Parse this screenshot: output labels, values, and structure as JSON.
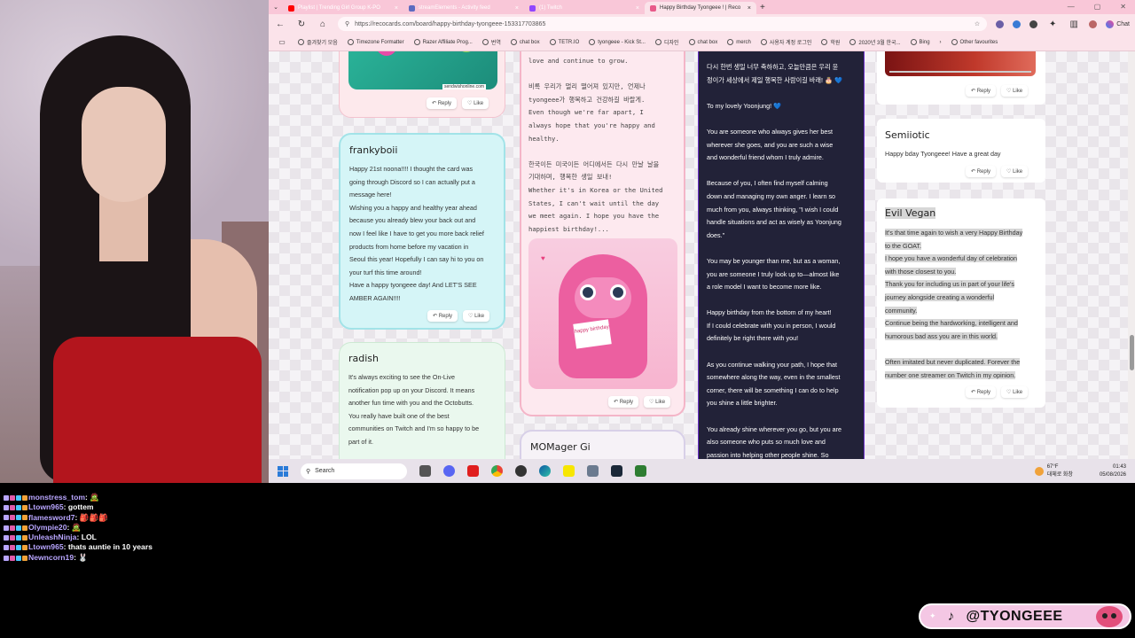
{
  "browser": {
    "tabs": [
      {
        "label": "Playlist | Trending Girl Group K-PO",
        "color": "#ff0000"
      },
      {
        "label": "streamElements - Activity feed",
        "color": "#5c6bc0"
      },
      {
        "label": "(1) Twitch",
        "color": "#9146ff"
      },
      {
        "label": "Happy Birthday Tyongeee ! | Reco",
        "color": "#e85a8a",
        "active": true
      }
    ],
    "new_tab": "+",
    "close_glyph": "×",
    "url": "https://recocards.com/board/happy-birthday-tyongeee-153317703865",
    "chat_label": "Chat",
    "bookmarks": [
      "즐겨찾기 모음",
      "Timezone Formatter",
      "Razer Affiliate Prog...",
      "번역",
      "chat box",
      "TETR.IO",
      "tyongeee - Kick St...",
      "디자인",
      "chat box",
      "merch",
      "사용자 계정 로그인",
      "학원",
      "2020년 3월 한국...",
      "Bing"
    ],
    "other_favourites": "Other favourites"
  },
  "board": {
    "reply": "Reply",
    "like": "Like",
    "col1": {
      "gif_caption": "sendwishonline.com",
      "frankyboii": {
        "name": "frankyboii",
        "lines": [
          "Happy 21st noona!!!! I thought the card was",
          "going through Discord so I can actually put a",
          "message here!",
          "Wishing you a happy and healthy year ahead",
          "because you already blew your back out and",
          "now I feel like I have to get you more back relief",
          "products from home before my vacation in",
          "Seoul this year! Hopefully I can say hi to you on",
          "your turf this time around!",
          "Have a happy tyongeee day! And LET'S SEE",
          "AMBER AGAIN!!!!"
        ]
      },
      "radish": {
        "name": "radish",
        "lines": [
          "It's always exciting to see the On-Live",
          "notification pop up on your Discord.  It means",
          "another fun time with you and the Octobutts.",
          "You really have built one of the best",
          "communities on Twitch and I'm so happy to be",
          "part of it."
        ]
      }
    },
    "col2": {
      "lines": [
        "love and continue to grow.",
        "",
        "비록 우리가 멀리 떨어져 있지만, 언제나",
        "tyongeee가 행복하고 건강하길 바랄게.",
        "Even though we're far apart, I",
        "always hope that you're happy and",
        "healthy.",
        "",
        "한국이든 미국이든 어디에서든 다시 만날 날을",
        "기대하며, 행복한 생일 보내!",
        "Whether it's in Korea or the United",
        "States, I can't wait until the day",
        "we meet again. I hope you have the",
        "happiest birthday!..."
      ],
      "sign_text": "happy birthday",
      "next_name": "MOMager Gi"
    },
    "col3": {
      "lines": [
        "다시 한번 생일 너무 축하하고, 오늘만큼은 우리 윤",
        "정이가 세상에서 제일 행복한 사람이길 바래! 🎂 💙",
        "",
        "To my lovely Yoonjung! 💙",
        "",
        "You are someone who always gives her best",
        "wherever she goes, and you are such a wise",
        "and wonderful friend whom I truly admire.",
        "",
        "Because of you, I often find myself calming",
        "down and managing my own anger. I learn so",
        "much from you, always thinking, \"I wish I could",
        "handle situations and act as wisely as Yoonjung",
        "does.\"",
        "",
        "You may be younger than me, but as a woman,",
        "you are someone I truly look up to—almost like",
        "a role model I want to become more like.",
        "",
        "Happy birthday from the bottom of my heart!",
        "If I could celebrate with you in person, I would",
        "definitely be right there with you!",
        "",
        "As you continue walking your path, I hope that",
        "somewhere along the way, even in the smallest",
        "corner, there will be something I can do to help",
        "you shine a little brighter.",
        "",
        "You already shine wherever you go, but you are",
        "also someone who puts so much love and",
        "passion into helping other people shine. So"
      ]
    },
    "col4": {
      "semiiotic": {
        "name": "Semiiotic",
        "text": "Happy bday Tyongeee! Have a great day"
      },
      "evil_vegan": {
        "name": "Evil Vegan",
        "lines": [
          "It's that time again to wish a very Happy Birthday",
          "to the GOAT.",
          "I hope you have a wonderful day of celebration",
          "with those closest to you.",
          "Thank you for including us in part of your life's",
          "journey alongside creating a wonderful",
          "community.",
          "Continue being the hardworking, intelligent and",
          "humorous bad ass you are in this world.",
          "",
          "Often imitated but never duplicated. Forever the",
          "number one streamer on Twitch in my opinion."
        ]
      }
    }
  },
  "taskbar": {
    "search_placeholder": "Search",
    "weather_temp": "67°F",
    "weather_desc": "대체로 화창",
    "time": "01:43",
    "date": "05/08/2026"
  },
  "chat": [
    {
      "user": "monstress_tom",
      "text": "🧟",
      "color": "#b9a6ff"
    },
    {
      "user": "Ltown965",
      "text": "gottem",
      "color": "#b9a6ff"
    },
    {
      "user": "flamesword7",
      "text": "🎒🎒🎒",
      "color": "#b9a6ff"
    },
    {
      "user": "Olympie20",
      "text": "🧟",
      "color": "#b9a6ff"
    },
    {
      "user": "UnleashNinja",
      "text": "LOL",
      "color": "#b9a6ff"
    },
    {
      "user": "Ltown965",
      "text": "thats auntie in 10 years",
      "color": "#b9a6ff"
    },
    {
      "user": "Newncorn19",
      "text": "🐰",
      "color": "#b9a6ff"
    }
  ],
  "banner": {
    "handle": "@TYONGEEE"
  }
}
